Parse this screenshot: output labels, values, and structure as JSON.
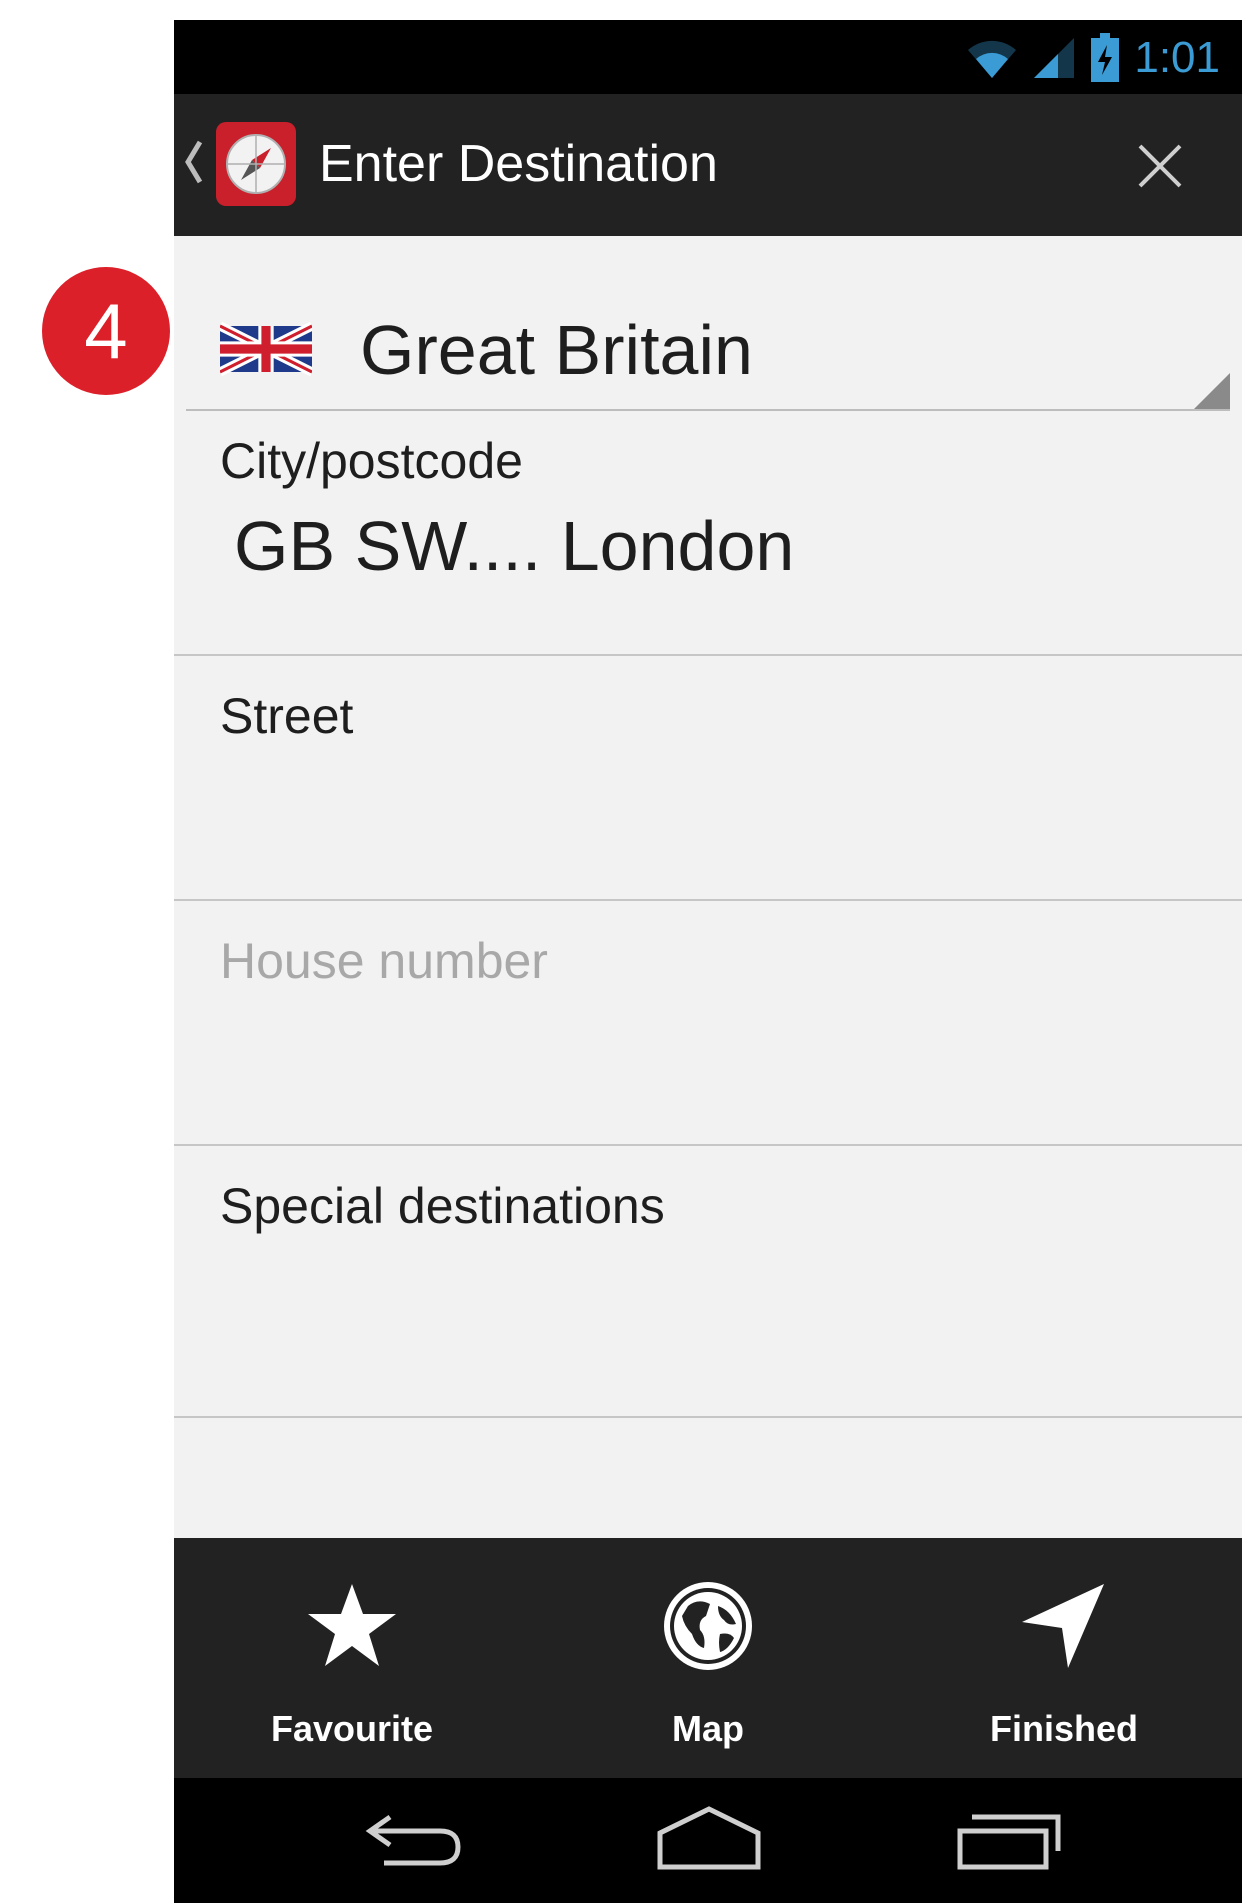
{
  "badge": {
    "step": "4"
  },
  "status_bar": {
    "time": "1:01"
  },
  "action_bar": {
    "title": "Enter Destination"
  },
  "country": {
    "name": "Great Britain"
  },
  "fields": {
    "city": {
      "label": "City/postcode",
      "value": "GB SW.... London"
    },
    "street": {
      "label": "Street"
    },
    "house_number": {
      "placeholder": "House number"
    },
    "special": {
      "label": "Special destinations"
    }
  },
  "bottom_bar": {
    "favourite": "Favourite",
    "map": "Map",
    "finished": "Finished"
  },
  "colors": {
    "accent_red": "#dc2029",
    "status_blue": "#3a9bd5",
    "bar_dark": "#222222"
  }
}
